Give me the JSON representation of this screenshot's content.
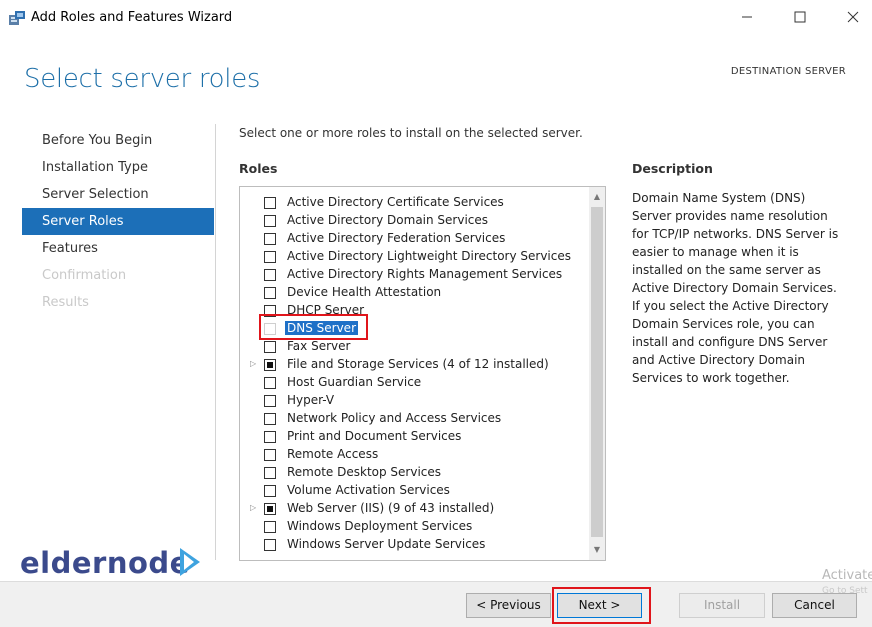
{
  "window": {
    "title": "Add Roles and Features Wizard",
    "controls": [
      "minimize",
      "maximize",
      "close"
    ]
  },
  "page": {
    "title": "Select server roles",
    "destination_label": "DESTINATION SERVER",
    "instruction": "Select one or more roles to install on the selected server."
  },
  "nav": {
    "items": [
      {
        "label": "Before You Begin",
        "state": "normal"
      },
      {
        "label": "Installation Type",
        "state": "normal"
      },
      {
        "label": "Server Selection",
        "state": "normal"
      },
      {
        "label": "Server Roles",
        "state": "active"
      },
      {
        "label": "Features",
        "state": "normal"
      },
      {
        "label": "Confirmation",
        "state": "disabled"
      },
      {
        "label": "Results",
        "state": "disabled"
      }
    ]
  },
  "roles": {
    "heading": "Roles",
    "items": [
      {
        "label": "Active Directory Certificate Services",
        "state": "unchecked"
      },
      {
        "label": "Active Directory Domain Services",
        "state": "unchecked"
      },
      {
        "label": "Active Directory Federation Services",
        "state": "unchecked"
      },
      {
        "label": "Active Directory Lightweight Directory Services",
        "state": "unchecked"
      },
      {
        "label": "Active Directory Rights Management Services",
        "state": "unchecked"
      },
      {
        "label": "Device Health Attestation",
        "state": "unchecked"
      },
      {
        "label": "DHCP Server",
        "state": "unchecked"
      },
      {
        "label": "DNS Server",
        "state": "unchecked",
        "selected": true
      },
      {
        "label": "Fax Server",
        "state": "unchecked"
      },
      {
        "label": "File and Storage Services (4 of 12 installed)",
        "state": "partial",
        "expandable": true
      },
      {
        "label": "Host Guardian Service",
        "state": "unchecked"
      },
      {
        "label": "Hyper-V",
        "state": "unchecked"
      },
      {
        "label": "Network Policy and Access Services",
        "state": "unchecked"
      },
      {
        "label": "Print and Document Services",
        "state": "unchecked"
      },
      {
        "label": "Remote Access",
        "state": "unchecked"
      },
      {
        "label": "Remote Desktop Services",
        "state": "unchecked"
      },
      {
        "label": "Volume Activation Services",
        "state": "unchecked"
      },
      {
        "label": "Web Server (IIS) (9 of 43 installed)",
        "state": "partial",
        "expandable": true
      },
      {
        "label": "Windows Deployment Services",
        "state": "unchecked"
      },
      {
        "label": "Windows Server Update Services",
        "state": "unchecked"
      }
    ]
  },
  "description": {
    "heading": "Description",
    "text": "Domain Name System (DNS) Server provides name resolution for TCP/IP networks. DNS Server is easier to manage when it is installed on the same server as Active Directory Domain Services. If you select the Active Directory Domain Services role, you can install and configure DNS Server and Active Directory Domain Services to work together."
  },
  "buttons": {
    "previous": "< Previous",
    "next": "Next >",
    "install": "Install",
    "cancel": "Cancel"
  },
  "watermark": {
    "logo_text": "eldernode",
    "activate": "Activate",
    "activate_sub": "Go to Sett"
  },
  "colors": {
    "accent": "#1c6fb8",
    "title_blue": "#1d6fa8",
    "highlight_red": "#e0151b",
    "logo_navy": "#3b4a8c",
    "logo_blue": "#3ea3df"
  }
}
